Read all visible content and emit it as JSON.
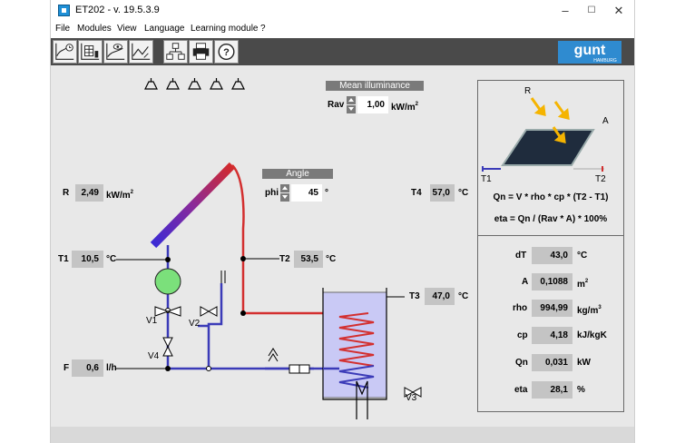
{
  "window": {
    "title": "ET202 - v. 19.5.3.9",
    "controls": {
      "minimize": "–",
      "maximize": "☐",
      "close": "✕"
    }
  },
  "menu": [
    "File",
    "Modules",
    "View",
    "Language",
    "Learning module",
    "?"
  ],
  "toolbar": {
    "buttons": [
      "chart-time-icon",
      "chart-table-icon",
      "chart-view-icon",
      "chart-compare-icon",
      "network-icon",
      "printer-icon",
      "help-icon"
    ],
    "logo_text": "gunt",
    "logo_sub": "HAMBURG"
  },
  "illuminance": {
    "title": "Mean illuminance",
    "label": "Rav",
    "value": "1,00",
    "unit": "kW/m"
  },
  "angle": {
    "title": "Angle",
    "label": "phi",
    "value": "45",
    "unit": "°"
  },
  "sensors": {
    "R": {
      "label": "R",
      "value": "2,49",
      "unit": "kW/m"
    },
    "T1": {
      "label": "T1",
      "value": "10,5",
      "unit": "°C"
    },
    "T2": {
      "label": "T2",
      "value": "53,5",
      "unit": "°C"
    },
    "T3": {
      "label": "T3",
      "value": "47,0",
      "unit": "°C"
    },
    "T4": {
      "label": "T4",
      "value": "57,0",
      "unit": "°C"
    },
    "F": {
      "label": "F",
      "value": "0,6",
      "unit": "l/h"
    }
  },
  "valves": [
    "V1",
    "V2",
    "V3",
    "V4"
  ],
  "collector_diagram": {
    "R": "R",
    "A": "A",
    "T1": "T1",
    "T2": "T2"
  },
  "formulas": {
    "qn": "Qn = V * rho * cp * (T2 - T1)",
    "eta": "eta = Qn / (Rav * A) * 100%"
  },
  "results": [
    {
      "label": "dT",
      "value": "43,0",
      "unit": "°C"
    },
    {
      "label": "A",
      "value": "0,1088",
      "unit": "m"
    },
    {
      "label": "rho",
      "value": "994,99",
      "unit": "kg/m"
    },
    {
      "label": "cp",
      "value": "4,18",
      "unit": "kJ/kgK"
    },
    {
      "label": "Qn",
      "value": "0,031",
      "unit": "kW"
    },
    {
      "label": "eta",
      "value": "28,1",
      "unit": "%"
    }
  ],
  "result_unit_exponents": {
    "A": "2",
    "rho": "3"
  },
  "irradiance_exponent": "2",
  "colors": {
    "cold": "#3b3bb8",
    "hot": "#d32f2f",
    "pump": "#7be07b",
    "tank": "#c9c9f5",
    "sensor_box": "#c4c4c4"
  }
}
